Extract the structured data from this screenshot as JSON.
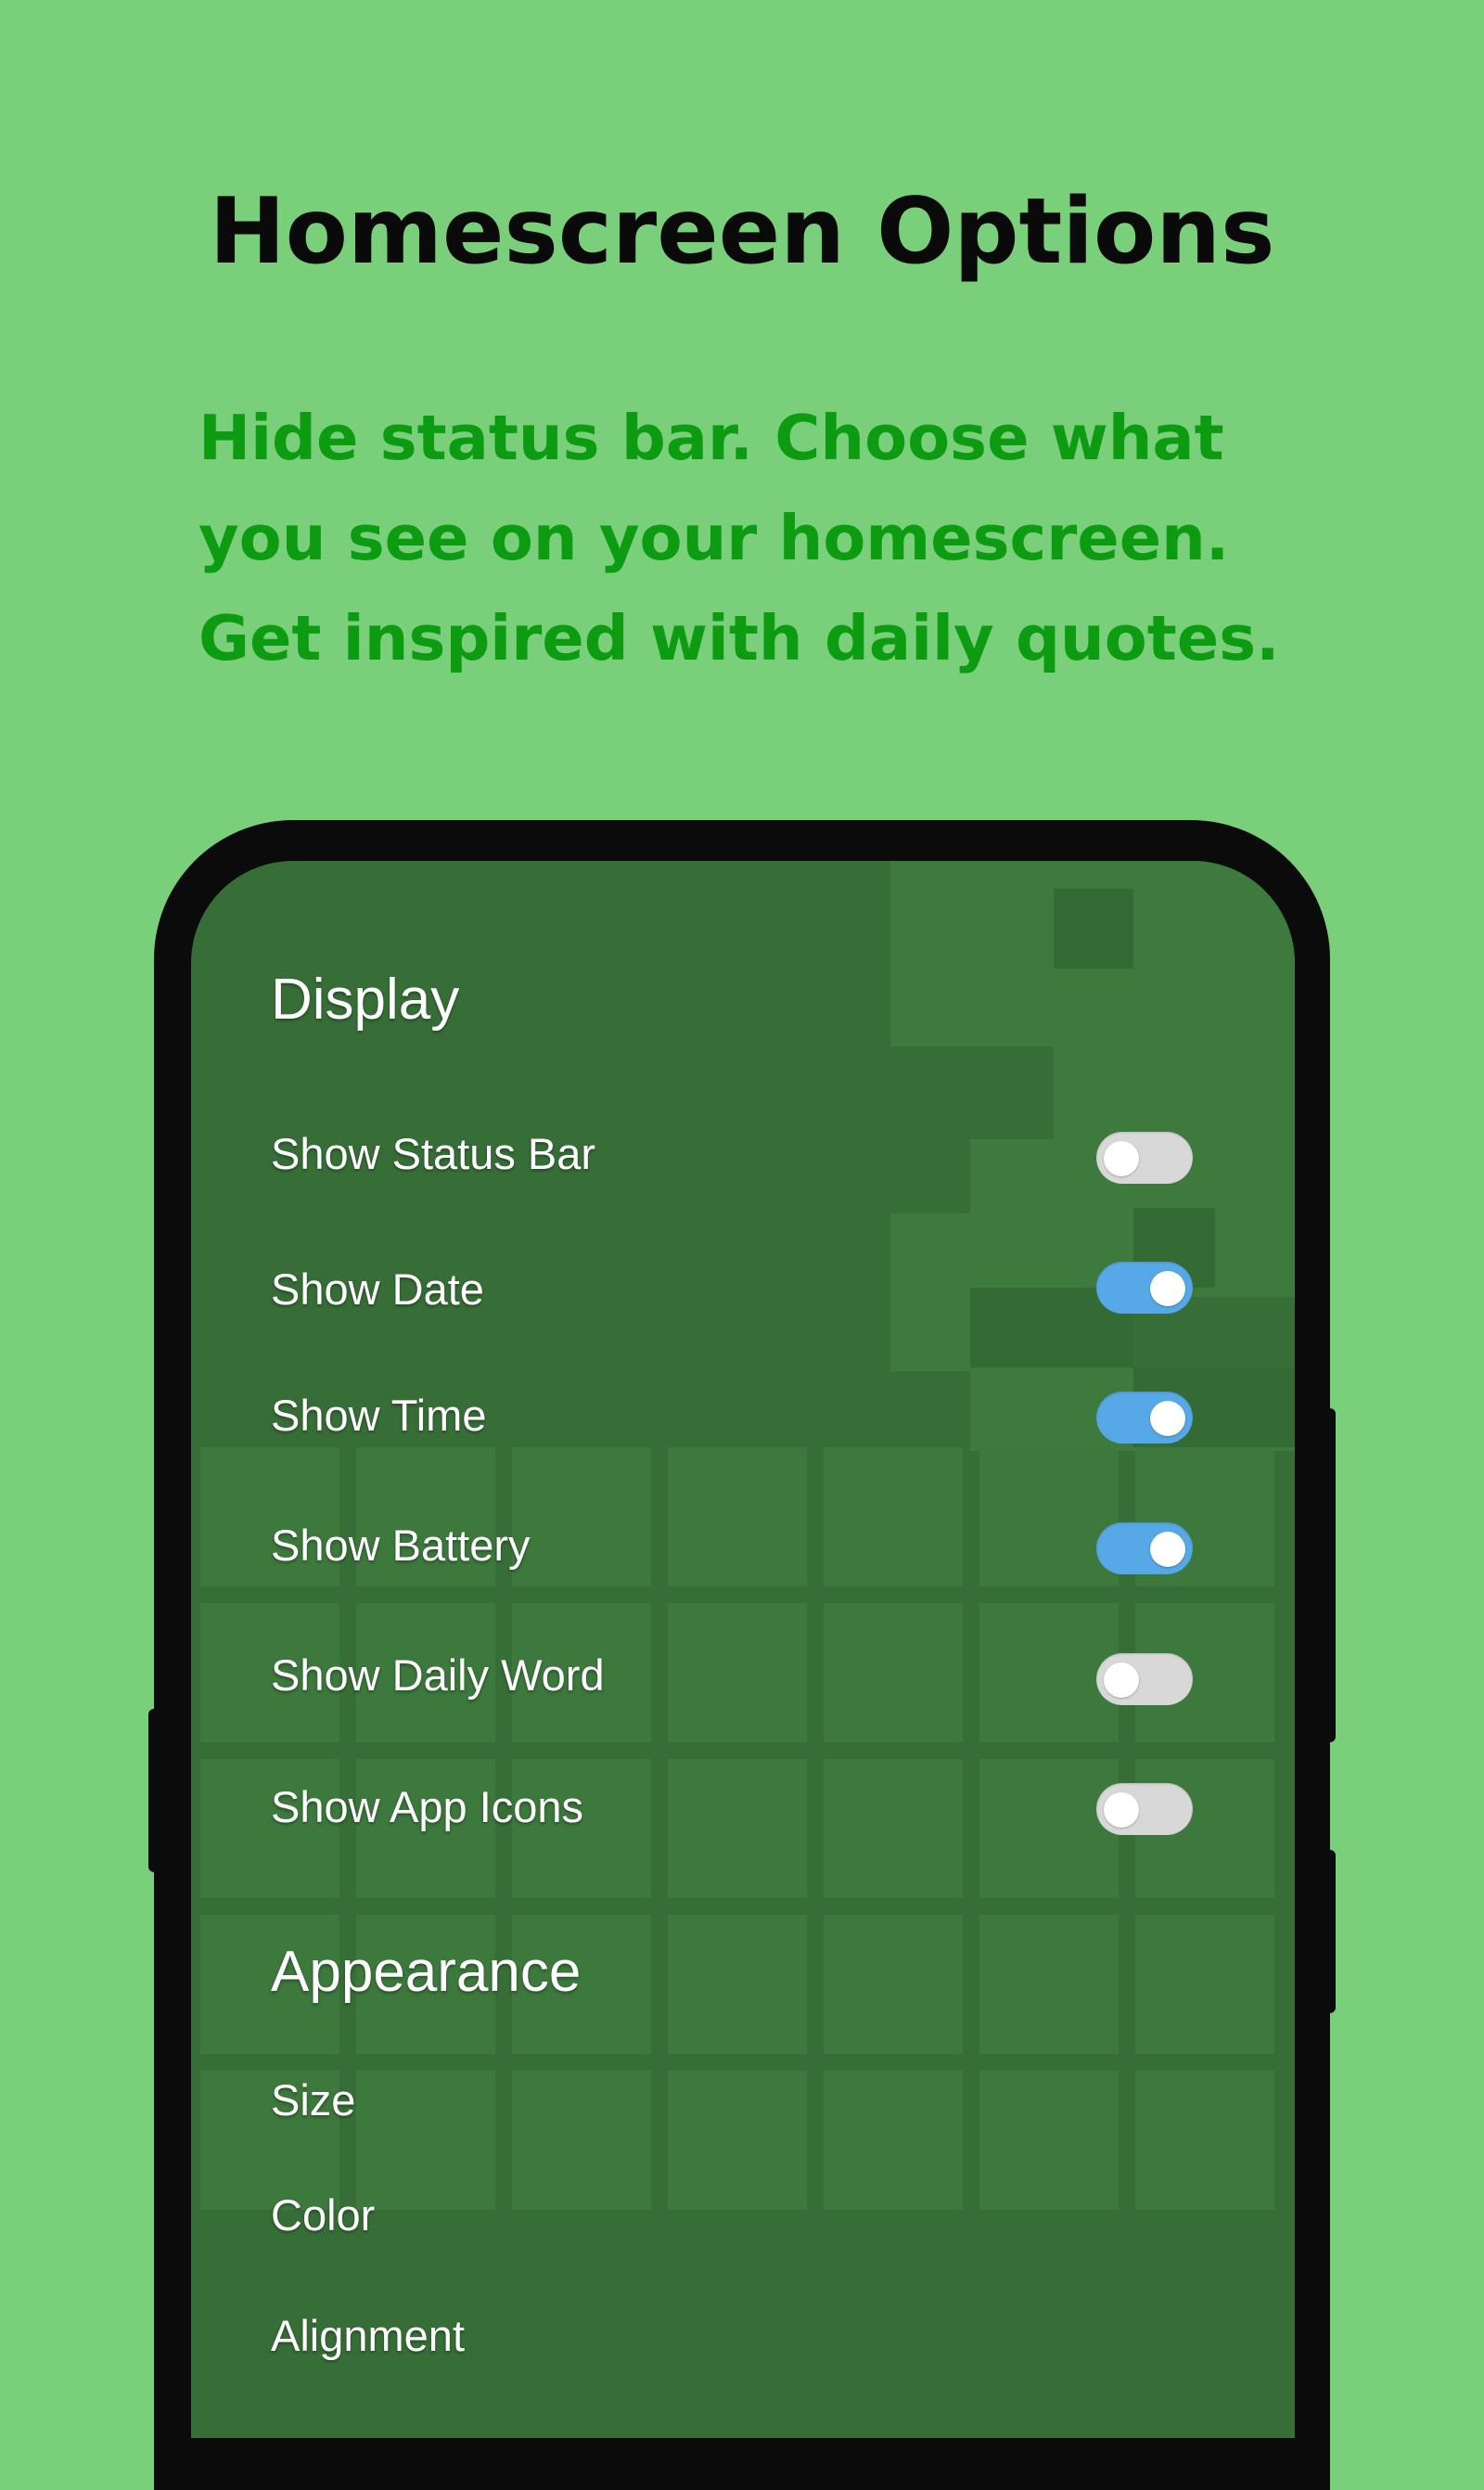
{
  "headline": "Homescreen Options",
  "subheadline_lines": [
    "Hide status bar. Choose what",
    "you see on your homescreen.",
    "Get inspired with daily quotes."
  ],
  "colors": {
    "background": "#79cf7a",
    "subheadline": "#0d9b12",
    "screen": "#376e37",
    "toggle_on": "#57a8e6",
    "toggle_off": "#d8d8d8"
  },
  "settings": {
    "display": {
      "title": "Display",
      "rows": [
        {
          "label": "Show Status Bar",
          "on": false
        },
        {
          "label": "Show Date",
          "on": true
        },
        {
          "label": "Show Time",
          "on": true
        },
        {
          "label": "Show Battery",
          "on": true
        },
        {
          "label": "Show Daily Word",
          "on": false
        },
        {
          "label": "Show App Icons",
          "on": false
        }
      ]
    },
    "appearance": {
      "title": "Appearance",
      "rows": [
        {
          "label": "Size"
        },
        {
          "label": "Color"
        },
        {
          "label": "Alignment"
        }
      ]
    }
  }
}
